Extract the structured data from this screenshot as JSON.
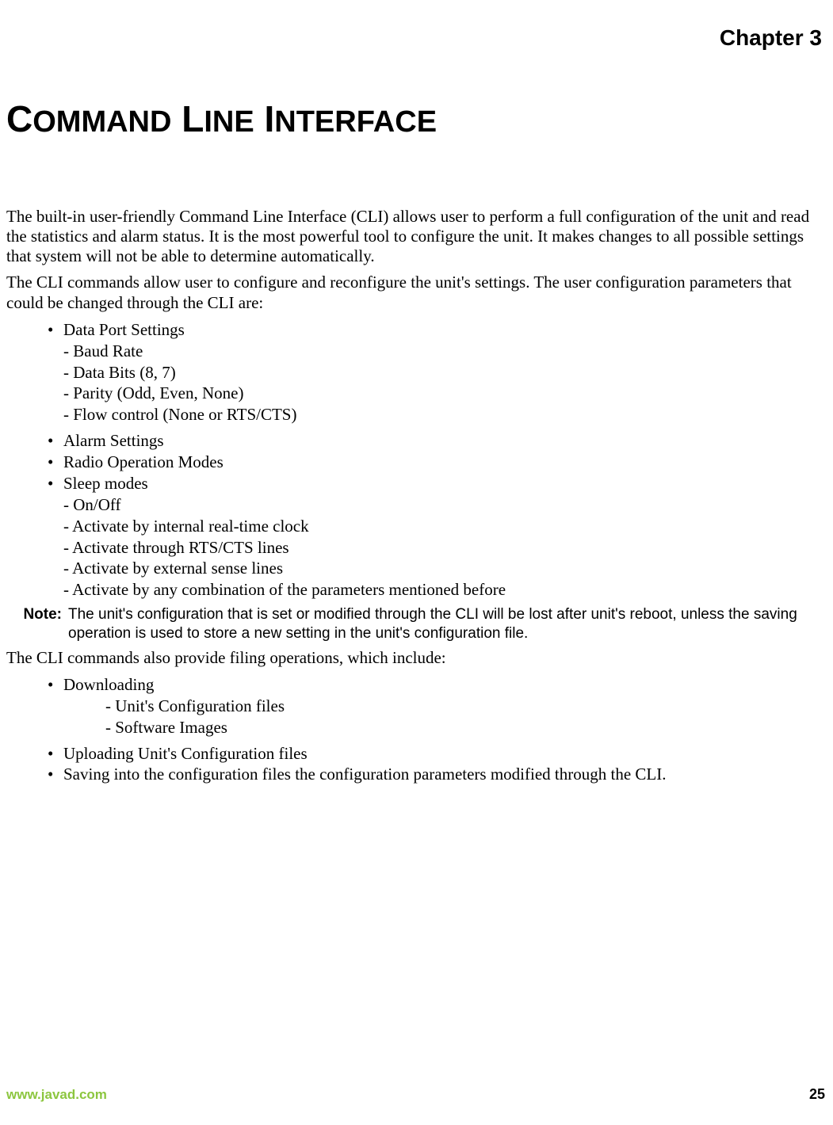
{
  "header": {
    "chapter_label": "Chapter 3"
  },
  "title": {
    "w1a": "C",
    "w1b": "OMMAND",
    "w2a": "L",
    "w2b": "INE",
    "w3a": "I",
    "w3b": "NTERFACE"
  },
  "intro": {
    "p1": "The built-in user-friendly Command Line Interface (CLI) allows user to perform a full configuration of the unit and read the statistics and alarm status. It is the most powerful tool to configure the unit. It makes changes to all possible settings that system will not be able to determine automatically.",
    "p2": "The CLI commands allow user to configure and reconfigure the unit's settings. The user configuration parameters that could be changed through the CLI are:"
  },
  "list1": {
    "i0": "Data Port Settings",
    "i0s0": "- Baud Rate",
    "i0s1": "- Data Bits (8, 7)",
    "i0s2": "- Parity (Odd, Even, None)",
    "i0s3": "- Flow control (None or RTS/CTS)",
    "i1": "Alarm Settings",
    "i2": "Radio Operation Modes",
    "i3": "Sleep modes",
    "i3s0": "- On/Off",
    "i3s1": "- Activate by internal real-time clock",
    "i3s2": "- Activate through RTS/CTS lines",
    "i3s3": "- Activate by external sense lines",
    "i3s4": "- Activate by any combination of the parameters mentioned before"
  },
  "note": {
    "label": "Note:",
    "body": "The unit's configuration that is set or modified through the CLI will be lost after unit's reboot, unless the saving operation is used to store a new setting in the unit's configuration file."
  },
  "p3": "The CLI commands also provide filing operations, which include:",
  "list2": {
    "i0": "Downloading",
    "i0s0": "- Unit's Configuration files",
    "i0s1": "- Software Images",
    "i1": "Uploading Unit's Configuration files",
    "i2": "Saving into the configuration files the configuration parameters modified through the CLI."
  },
  "footer": {
    "url": "www.javad.com",
    "page": "25"
  }
}
